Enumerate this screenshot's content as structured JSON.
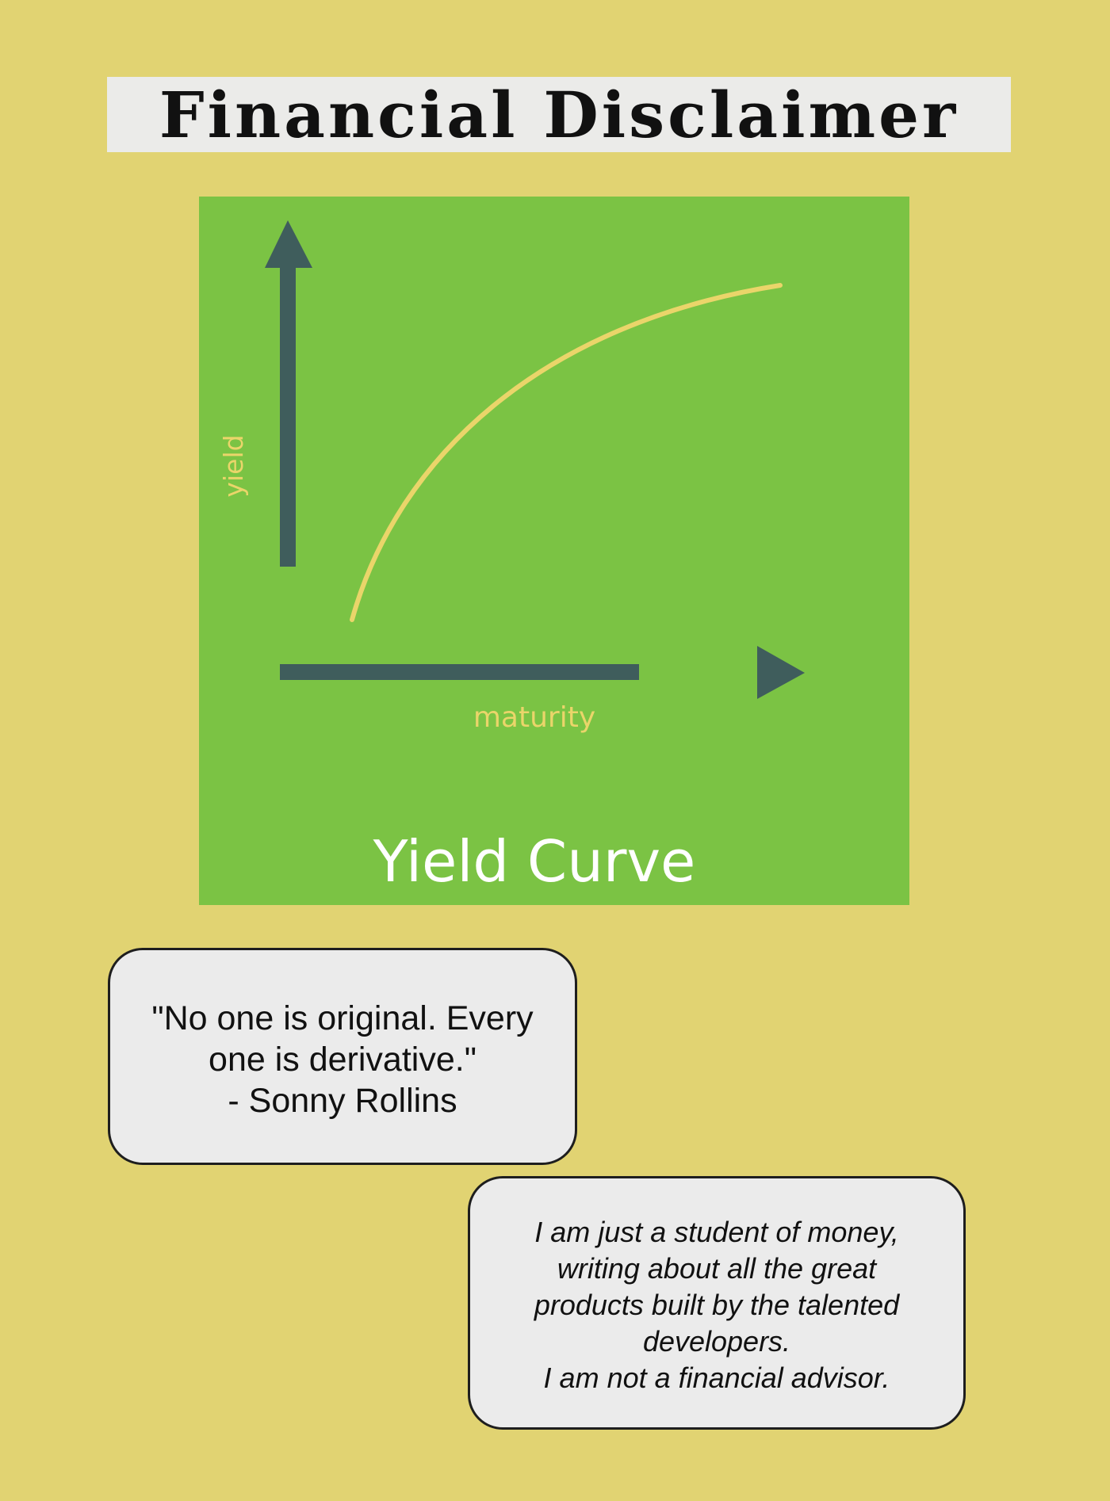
{
  "title": "Financial Disclaimer",
  "chart": {
    "title": "Yield Curve",
    "xlabel": "maturity",
    "ylabel": "yield",
    "colors": {
      "background": "#7bc344",
      "axes": "#3f5d5c",
      "curve": "#ead56a",
      "labels": "#ead56a",
      "title": "#ffffff"
    }
  },
  "quote": {
    "lines": [
      "\"No one is original. Every",
      "one is derivative.\"",
      "- Sonny Rollins"
    ]
  },
  "disclaimer": {
    "lines": [
      "I am just a student of money,",
      "writing about all the great",
      "products built by the talented",
      "developers.",
      "I am not a financial advisor."
    ]
  }
}
